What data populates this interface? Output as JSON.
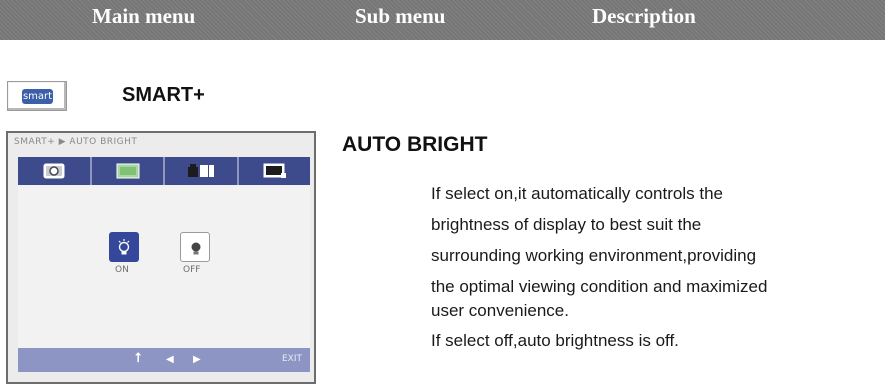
{
  "header": {
    "main_menu": "Main menu",
    "sub_menu": "Sub menu",
    "description": "Description"
  },
  "smart": {
    "button_text": "smart",
    "label": "SMART+"
  },
  "osd": {
    "title": "SMART+ ▶ AUTO BRIGHT",
    "tabs": [
      "picture-icon",
      "ratio-icon",
      "mode-icon",
      "display-icon"
    ],
    "options": [
      {
        "label": "ON",
        "icon": "bulb-on-icon",
        "selected": true
      },
      {
        "label": "OFF",
        "icon": "bulb-off-icon",
        "selected": false
      }
    ],
    "exit_label": "EXIT",
    "accent_color": "#34479a"
  },
  "description": {
    "title": "AUTO BRIGHT",
    "lines": [
      "If select on,it automatically controls the",
      "brightness of display to best suit the",
      "surrounding working environment,providing",
      "the optimal viewing condition and maximized",
      "user convenience.",
      "If select off,auto brightness is off."
    ]
  }
}
